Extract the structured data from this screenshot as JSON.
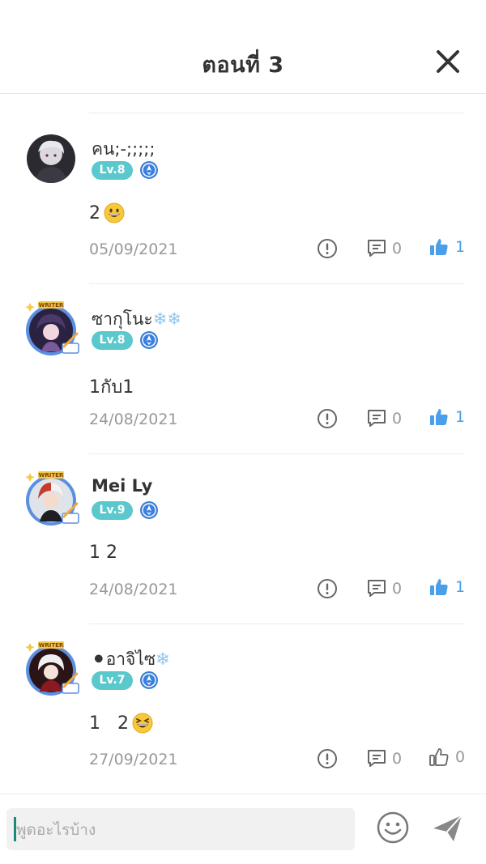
{
  "header": {
    "title": "ตอนที่ 3"
  },
  "comments": [
    {
      "username": "คน;-;;;;;",
      "level": "Lv.8",
      "body": "2",
      "emoji": "grinning-face",
      "date": "05/09/2021",
      "reply_count": "0",
      "like_count": "1",
      "liked": true,
      "writer_frame": false
    },
    {
      "username": "ซากุโนะ",
      "username_suffix_icons": [
        "snowflake-icon",
        "snowflake-icon"
      ],
      "level": "Lv.8",
      "body": "1กับ1",
      "date": "24/08/2021",
      "reply_count": "0",
      "like_count": "1",
      "liked": true,
      "writer_frame": true,
      "frame_label": "WRITER"
    },
    {
      "username": "Mei Ly",
      "level": "Lv.9",
      "body": "1 2",
      "date": "24/08/2021",
      "reply_count": "0",
      "like_count": "1",
      "liked": true,
      "writer_frame": true,
      "frame_label": "WRITER"
    },
    {
      "username": "อาจิไซ",
      "username_prefix_icon": "black-circle-icon",
      "username_suffix_icons": [
        "snowflake-icon"
      ],
      "level": "Lv.7",
      "body": "1   2",
      "emoji": "squinting-laughing-face",
      "date": "27/09/2021",
      "reply_count": "0",
      "like_count": "0",
      "liked": false,
      "writer_frame": true,
      "frame_label": "WRITER"
    }
  ],
  "composer": {
    "placeholder": "พูดอะไรบ้าง"
  },
  "colors": {
    "level_badge": "#5ac8cc",
    "like_active": "#4a9fe8",
    "muted_text": "#999999",
    "frame_blue": "#5b8fe0"
  }
}
